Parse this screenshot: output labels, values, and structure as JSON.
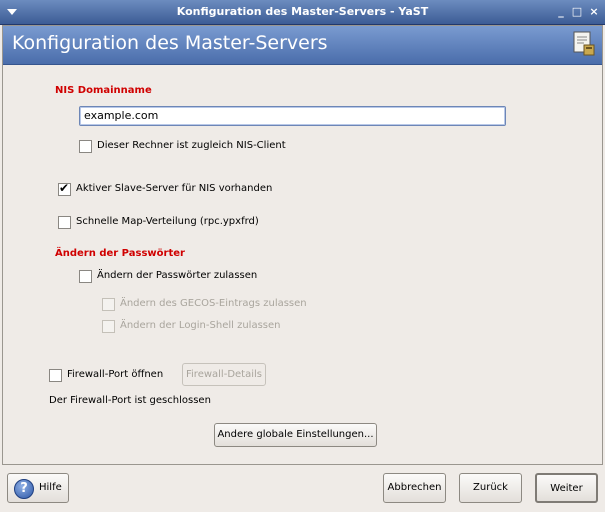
{
  "window": {
    "title": "Konfiguration des Master-Servers - YaST",
    "controls": {
      "minimize": "_",
      "maximize": "□",
      "close": "×"
    }
  },
  "header": {
    "title": "Konfiguration des Master-Servers"
  },
  "nis_domain": {
    "heading": "NIS Domainname",
    "value": "example.com",
    "is_client_label": "Dieser Rechner ist zugleich NIS-Client",
    "is_client_checked": false
  },
  "slave_server": {
    "label": "Aktiver Slave-Server für NIS vorhanden",
    "checked": true
  },
  "fast_map": {
    "label": "Schnelle Map-Verteilung (rpc.ypxfrd)",
    "checked": false
  },
  "passwords": {
    "heading": "Ändern der Passwörter",
    "allow_label": "Ändern der Passwörter zulassen",
    "gecos_label": "Ändern des GECOS-Eintrags zulassen",
    "shell_label": "Ändern der Login-Shell zulassen"
  },
  "firewall": {
    "open_label": "Firewall-Port öffnen",
    "details_label": "Firewall-Details",
    "status": "Der Firewall-Port ist geschlossen"
  },
  "other_settings_label": "Andere globale Einstellungen...",
  "bottom": {
    "help": "Hilfe",
    "cancel": "Abbrechen",
    "back": "Zurück",
    "next": "Weiter"
  }
}
